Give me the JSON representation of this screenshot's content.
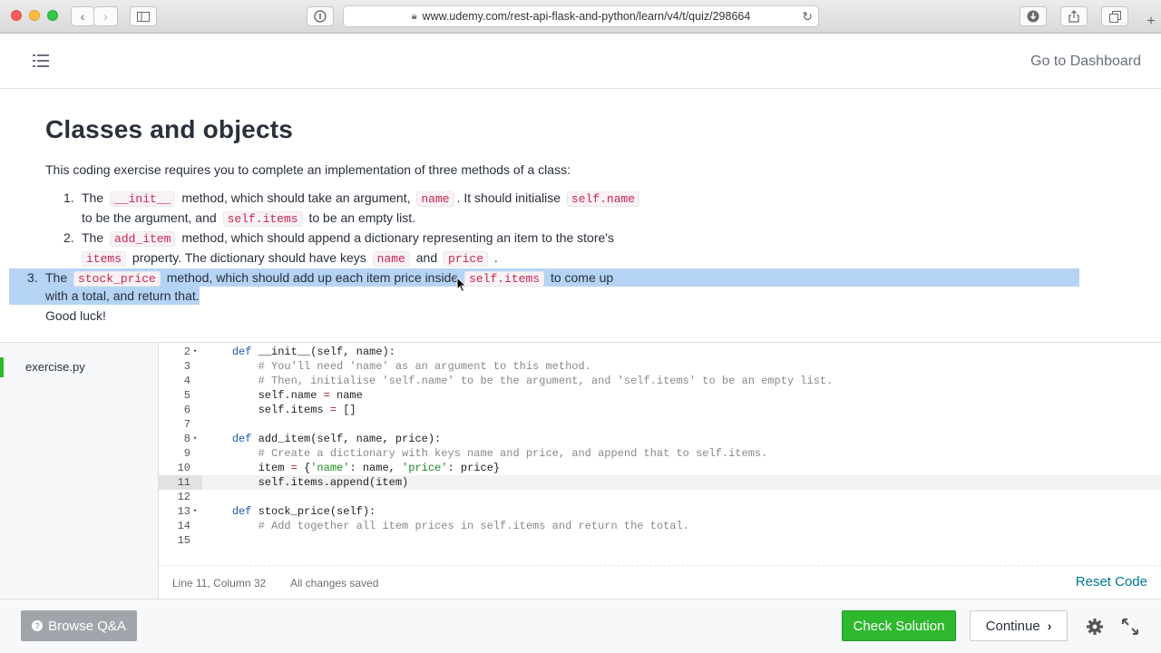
{
  "browser": {
    "url": "www.udemy.com/rest-api-flask-and-python/learn/v4/t/quiz/298664"
  },
  "header": {
    "dashboard_link": "Go to Dashboard"
  },
  "exercise": {
    "title": "Classes and objects",
    "intro": "This coding exercise requires you to complete an implementation of three methods of a class:",
    "tasks": [
      {
        "num": "1.",
        "p1": "The",
        "c1": "__init__",
        "p2": "method, which should take an argument,",
        "c2": "name",
        "p3": ". It should initialise",
        "c3": "self.name",
        "p4": "to be the argument, and",
        "c4": "self.items",
        "p5": "to be an empty list."
      },
      {
        "num": "2.",
        "p1": "The",
        "c1": "add_item",
        "p2": "method, which should append a dictionary representing an item to the store's",
        "c2": "items",
        "p3": "property. The dictionary should have keys",
        "c3": "name",
        "p4": "and",
        "c4": "price",
        "p5": "."
      },
      {
        "num": "3.",
        "p1": "The",
        "c1": "stock_price",
        "p2": "method, which should add up each item price inside",
        "c2": "self.items",
        "p3": "to come up",
        "p4": "with a total, and return that."
      }
    ],
    "closing": "Good luck!"
  },
  "editor": {
    "file_name": "exercise.py",
    "lines": [
      {
        "n": "2",
        "fold": true,
        "text": "    def __init__(self, name):"
      },
      {
        "n": "3",
        "fold": false,
        "text": "        # You'll need 'name' as an argument to this method."
      },
      {
        "n": "4",
        "fold": false,
        "text": "        # Then, initialise 'self.name' to be the argument, and 'self.items' to be an empty list."
      },
      {
        "n": "5",
        "fold": false,
        "text": "        self.name = name"
      },
      {
        "n": "6",
        "fold": false,
        "text": "        self.items = []"
      },
      {
        "n": "7",
        "fold": false,
        "text": ""
      },
      {
        "n": "8",
        "fold": true,
        "text": "    def add_item(self, name, price):"
      },
      {
        "n": "9",
        "fold": false,
        "text": "        # Create a dictionary with keys name and price, and append that to self.items."
      },
      {
        "n": "10",
        "fold": false,
        "text": "        item = {'name': name, 'price': price}"
      },
      {
        "n": "11",
        "fold": false,
        "text": "        self.items.append(item)"
      },
      {
        "n": "12",
        "fold": false,
        "text": ""
      },
      {
        "n": "13",
        "fold": true,
        "text": "    def stock_price(self):"
      },
      {
        "n": "14",
        "fold": false,
        "text": "        # Add together all item prices in self.items and return the total."
      },
      {
        "n": "15",
        "fold": false,
        "text": ""
      }
    ],
    "active_line": "11",
    "status_position": "Line 11, Column 32",
    "status_saved": "All changes saved",
    "reset_label": "Reset Code"
  },
  "footer": {
    "browse_label": "Browse Q&A",
    "check_label": "Check Solution",
    "continue_label": "Continue"
  },
  "colors": {
    "accent_green": "#2eb82e",
    "link_teal": "#007791",
    "selection": "#b5d3f5",
    "code_inline": "#c7254e"
  }
}
